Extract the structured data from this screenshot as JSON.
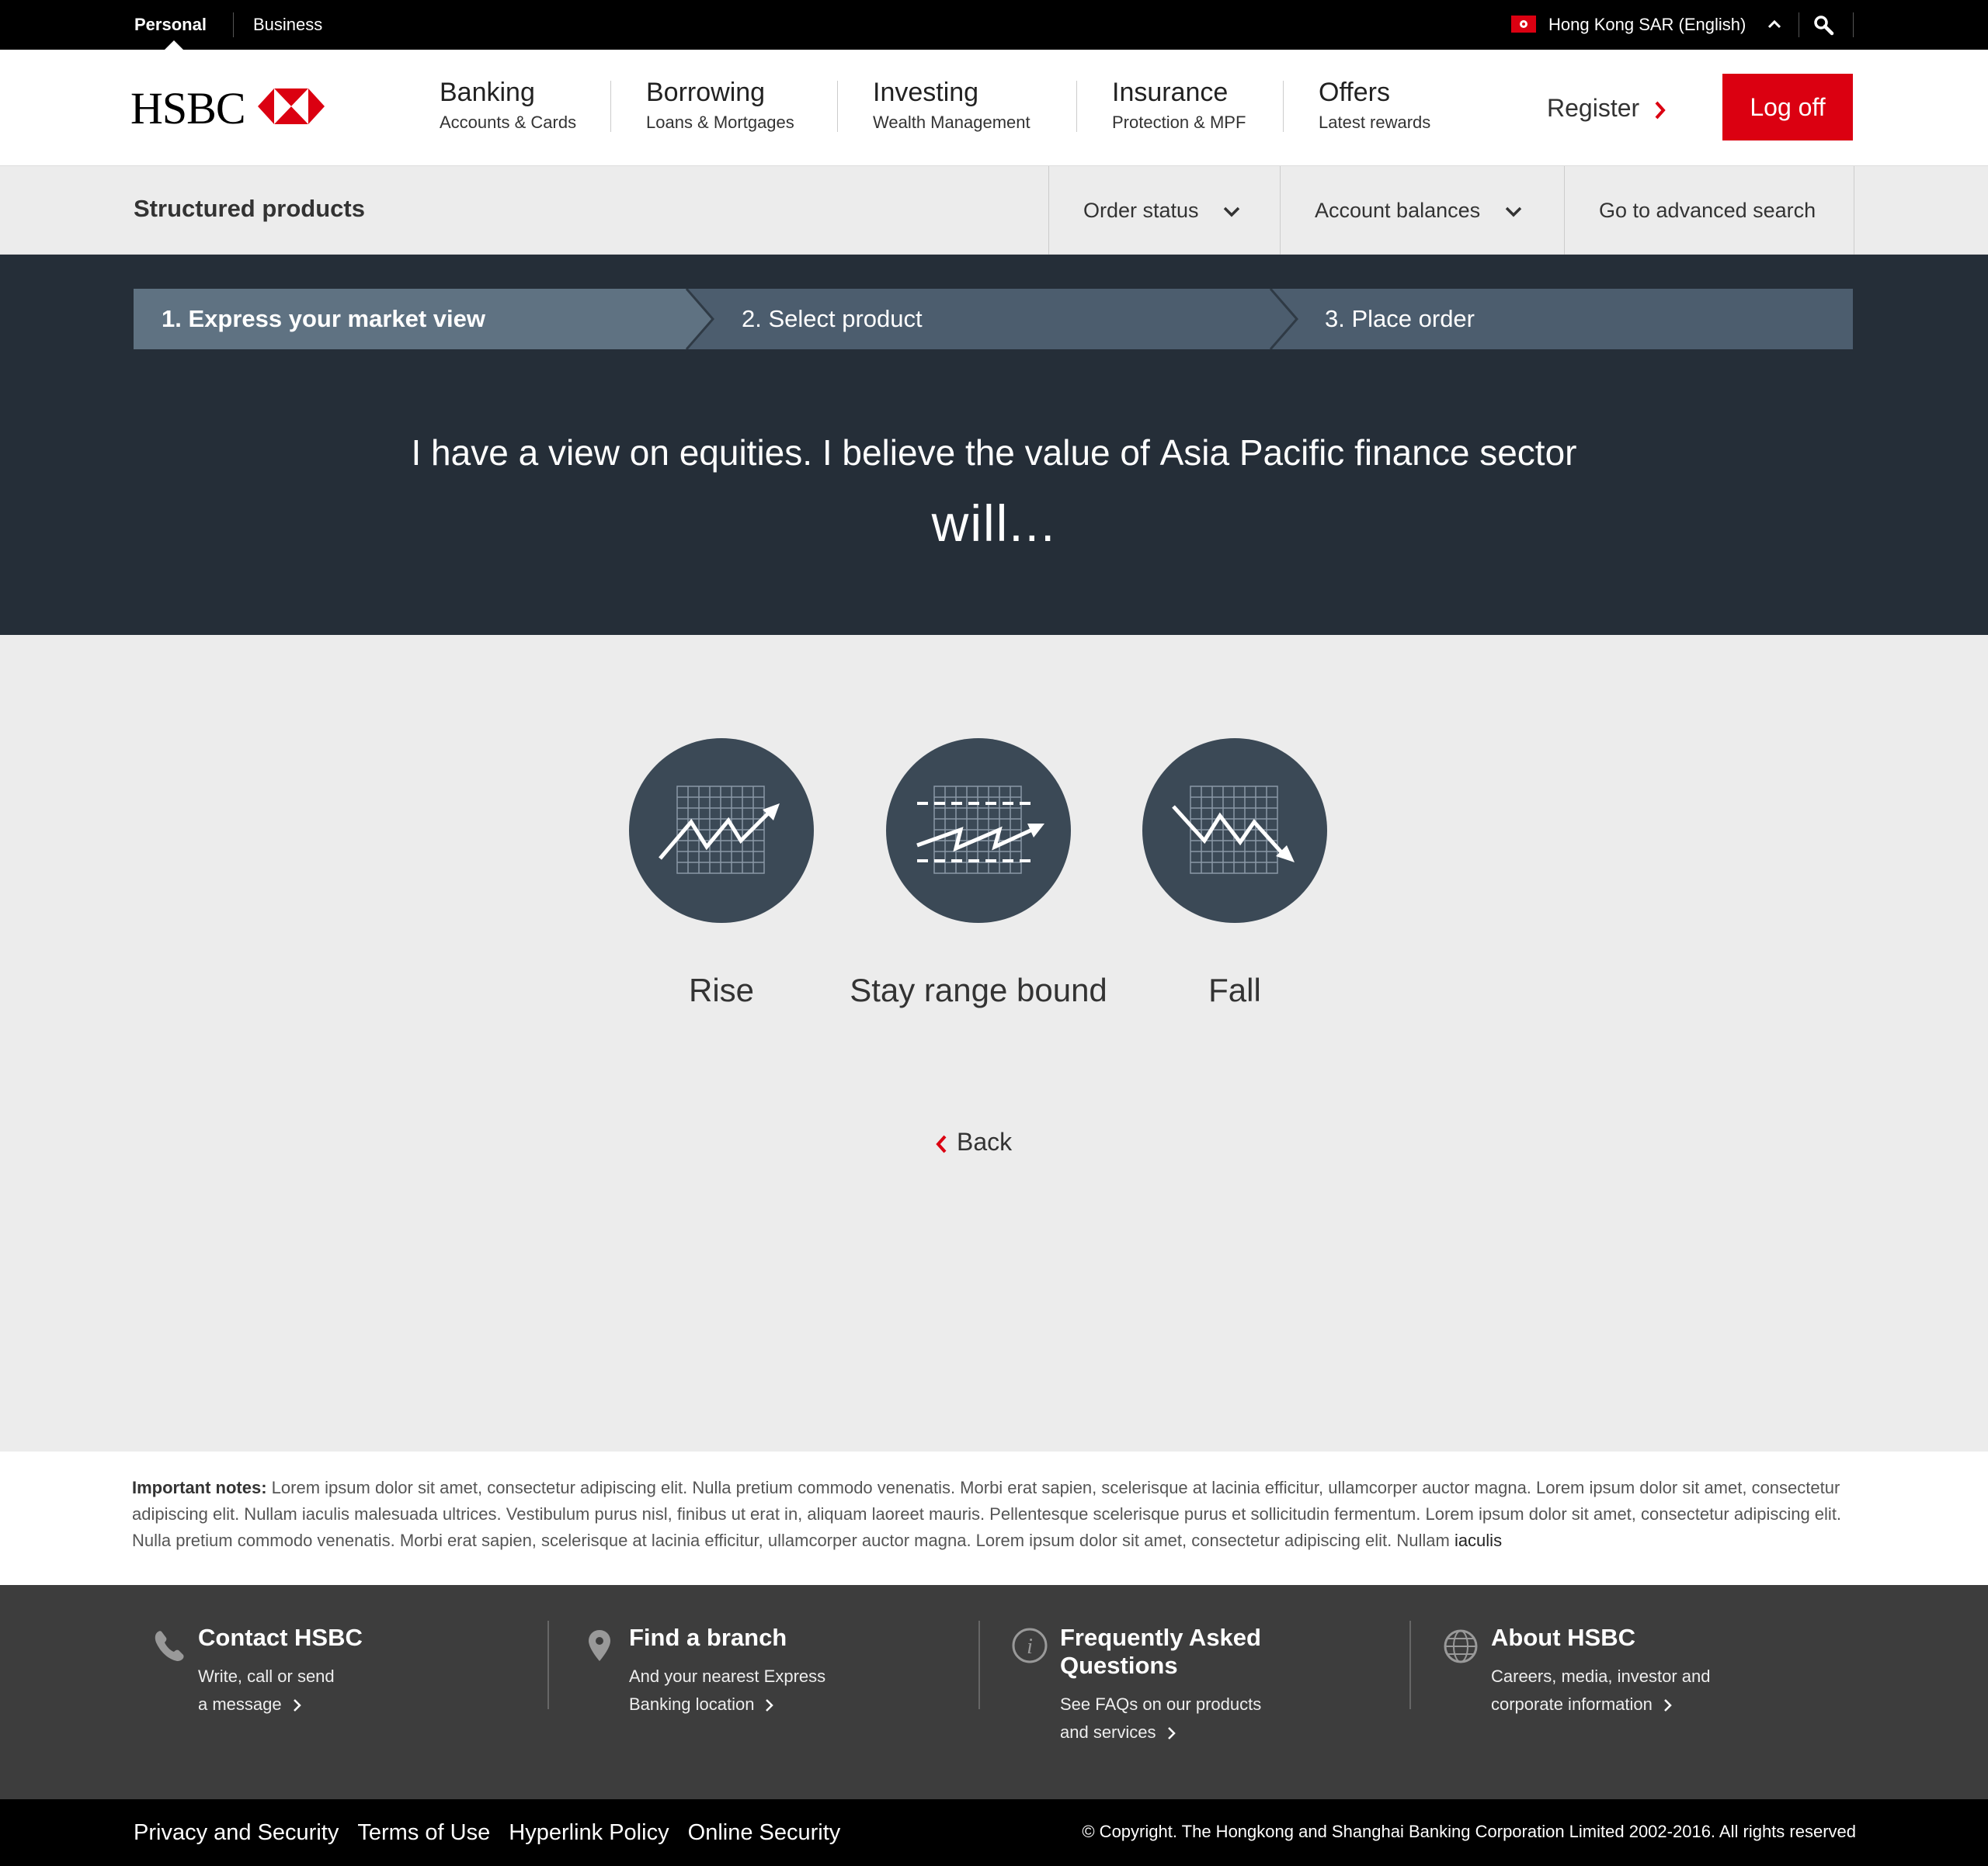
{
  "topbar": {
    "personal": "Personal",
    "business": "Business",
    "region": "Hong Kong SAR (English)"
  },
  "brand": {
    "logo_text": "HSBC",
    "accent": "#db0011"
  },
  "nav": {
    "items": [
      {
        "title": "Banking",
        "sub": "Accounts & Cards"
      },
      {
        "title": "Borrowing",
        "sub": "Loans & Mortgages"
      },
      {
        "title": "Investing",
        "sub": "Wealth Management"
      },
      {
        "title": "Insurance",
        "sub": "Protection & MPF"
      },
      {
        "title": "Offers",
        "sub": "Latest rewards"
      }
    ],
    "register": "Register",
    "logoff": "Log off"
  },
  "subnav": {
    "title": "Structured products",
    "order_status": "Order status",
    "account_balances": "Account balances",
    "advanced_search": "Go to advanced search"
  },
  "steps": [
    "1. Express your market view",
    "2. Select product",
    "3. Place order"
  ],
  "hero": {
    "p1": "I have a view on ",
    "b1": "equities",
    "p2": ". I believe the value of ",
    "b2": "Asia Pacific finance",
    "p3": " sector",
    "line2": "will..."
  },
  "options": [
    {
      "label": "Rise",
      "icon": "rise-chart-icon"
    },
    {
      "label": "Stay range bound",
      "icon": "range-chart-icon"
    },
    {
      "label": "Fall",
      "icon": "fall-chart-icon"
    }
  ],
  "back": "Back",
  "notes": {
    "label": "Important notes:",
    "text": " Lorem ipsum dolor sit amet, consectetur adipiscing elit. Nulla pretium commodo venenatis. Morbi erat sapien, scelerisque at lacinia efficitur, ullamcorper auctor magna. Lorem ipsum dolor sit amet, consectetur adipiscing elit. Nullam iaculis malesuada ultrices. Vestibulum purus nisl, finibus ut erat in, aliquam laoreet mauris. Pellentesque scelerisque purus et sollicitudin fermentum. Lorem ipsum dolor sit amet, consectetur adipiscing elit. Nulla pretium commodo venenatis. Morbi erat sapien, scelerisque at lacinia efficitur, ullamcorper auctor magna. Lorem ipsum dolor sit amet, consectetur adipiscing elit. Nullam ",
    "end": "iaculis"
  },
  "footer": {
    "cols": [
      {
        "title": "Contact HSBC",
        "l1": "Write, call or send",
        "l2": "a message"
      },
      {
        "title": "Find a branch",
        "l1": "And your nearest Express",
        "l2": "Banking location"
      },
      {
        "title": "Frequently Asked",
        "title2": "Questions",
        "l1": "See FAQs on our products",
        "l2": "and services"
      },
      {
        "title": "About HSBC",
        "l1": "Careers, media, investor and",
        "l2": "corporate information"
      }
    ]
  },
  "bottom": {
    "links": [
      "Privacy and Security",
      "Terms of Use",
      "Hyperlink Policy",
      "Online Security"
    ],
    "copyright": "© Copyright. The Hongkong and Shanghai Banking Corporation Limited 2002-2016. All rights reserved"
  }
}
